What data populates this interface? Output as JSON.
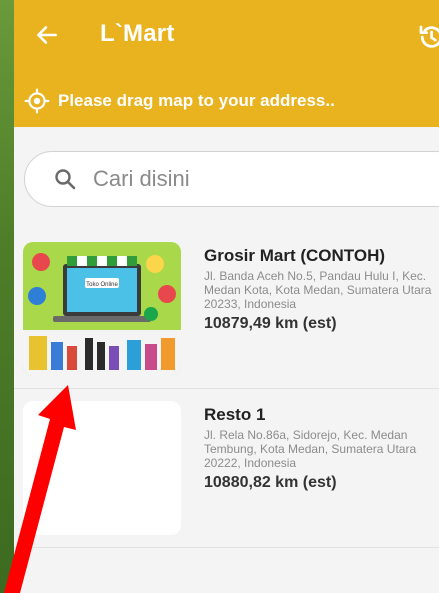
{
  "header": {
    "title": "L`Mart",
    "location_prompt": "Please drag map to your address..",
    "accent_color": "#e8b31e",
    "icons": [
      "back-arrow-icon",
      "history-icon",
      "gps-target-icon"
    ]
  },
  "search": {
    "placeholder": "Cari disini",
    "icon": "search-icon"
  },
  "stores": [
    {
      "name": "Grosir Mart (CONTOH)",
      "address": "Jl. Banda Aceh No.5, Pandau Hulu I, Kec. Medan Kota, Kota Medan, Sumatera Utara 20233, Indonesia",
      "distance": "10879,49 km (est)",
      "thumb_sign": "Toko Online"
    },
    {
      "name": "Resto 1",
      "address": "Jl. Rela No.86a, Sidorejo, Kec. Medan Tembung, Kota Medan, Sumatera Utara 20222, Indonesia",
      "distance": "10880,82 km (est)"
    }
  ],
  "annotation": {
    "arrow_color": "#ff0000"
  }
}
